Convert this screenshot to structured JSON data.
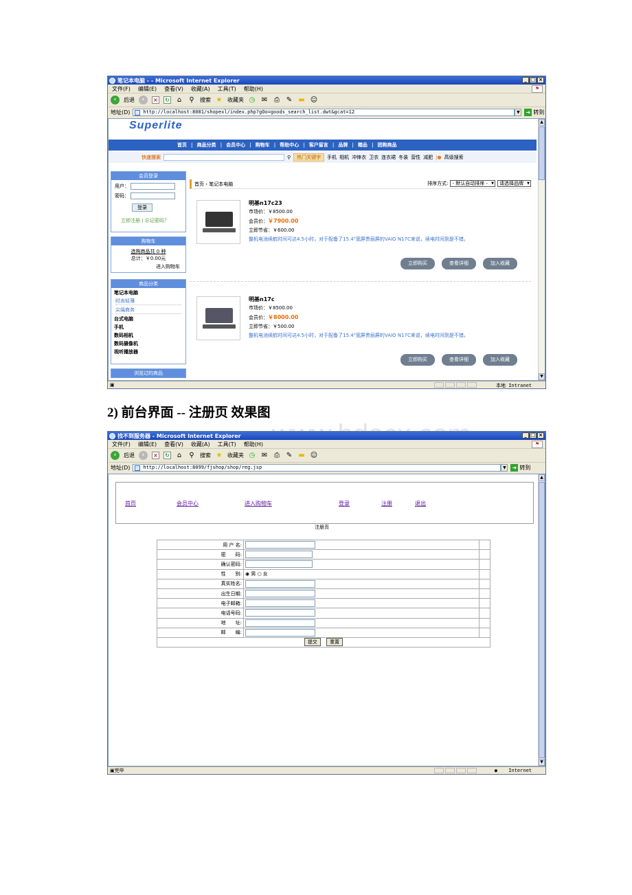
{
  "win1": {
    "title": "笔记本电脑 - - Microsoft Internet Explorer",
    "menu": [
      "文件(F)",
      "编辑(E)",
      "查看(V)",
      "收藏(A)",
      "工具(T)",
      "帮助(H)"
    ],
    "toolbar": {
      "back": "后退",
      "search": "搜索",
      "favorites": "收藏夹"
    },
    "address_label": "地址(D)",
    "address": "http://localhost:8081/shopexl/index.php?gOo=goods_search_list.dwt&gcat=12",
    "go": "转到",
    "status_zone": "本地 Intranet"
  },
  "shop": {
    "logo": "Superlite",
    "nav": [
      "首页",
      "商品分类",
      "会员中心",
      "购物车",
      "帮助中心",
      "客户留言",
      "品牌",
      "赠品",
      "团购商品"
    ],
    "search": {
      "label": "快速搜索",
      "hot": "热门关键字",
      "keywords": [
        "手机",
        "相机",
        "冲锋衣",
        "卫衣",
        "连衣裙",
        "冬装",
        "营性",
        "减肥"
      ],
      "advanced": "高级搜索"
    },
    "login": {
      "title": "会员登录",
      "user_label": "用户：",
      "pass_label": "密码：",
      "button": "登录",
      "register": "立即注册",
      "sep": "|",
      "forgot": "忘记密码？"
    },
    "cart": {
      "title": "购物车",
      "items": "选购商品共 0 种",
      "total": "总计：￥0.00元",
      "go": "进入购物车"
    },
    "categories": {
      "title": "商品分类",
      "items": [
        {
          "label": "笔记本电脑",
          "sub": false
        },
        {
          "label": "时尚轻薄",
          "sub": true
        },
        {
          "label": "尖端商务",
          "sub": true
        },
        {
          "label": "台式电脑",
          "sub": false
        },
        {
          "label": "手机",
          "sub": false
        },
        {
          "label": "数码相机",
          "sub": false
        },
        {
          "label": "数码摄像机",
          "sub": false
        },
        {
          "label": "视听播放器",
          "sub": false
        }
      ],
      "next_panel": "浏览过的商品"
    },
    "breadcrumb": "首页 › 笔记本电脑",
    "sort": {
      "label": "排序方式:",
      "order": "- 默认自动排序 -",
      "brand": "请选择品牌"
    },
    "products": [
      {
        "name": "明基n17c23",
        "market": "市场价：￥8500.00",
        "member_label": "会员价：",
        "member": "￥7900.00",
        "save": "立即节省：￥600.00",
        "desc": "整机电池续航时间可达4.5小时，对于配备了15.4\"宽屏贵丽屏的VAIO N17C来说，续电时间到是不错。"
      },
      {
        "name": "明基n17c",
        "market": "市场价：￥8500.00",
        "member_label": "会员价：",
        "member": "￥8000.00",
        "save": "立即节省：￥500.00",
        "desc": "整机电池续航时间可达4.5小时，对于配备了15.4\"宽屏贵丽屏的VAIO N17C来说，续电时间到是不错。"
      }
    ],
    "product_buttons": [
      "立即购买",
      "查看详细",
      "加入收藏"
    ]
  },
  "heading": "2) 前台界面 -- 注册页 效果图",
  "watermark": "www.bdocx.com",
  "win2": {
    "title": "找不到服务器 - Microsoft Internet Explorer",
    "address": "http://localhost:8099/fjshop/shop/reg.jsp",
    "status": "完毕",
    "status_zone": "Internet"
  },
  "reg": {
    "nav": [
      "首页",
      "会员中心",
      "进入购物车",
      "登录",
      "注册",
      "退出"
    ],
    "title": "注册页",
    "fields": [
      "用 户 名:",
      "密　　码:",
      "确认密码:",
      "性　　别:",
      "真实姓名:",
      "出生日期:",
      "电子邮箱:",
      "电话号码:",
      "地　　址:",
      "邮　　编:"
    ],
    "gender": {
      "male": "男",
      "female": "女"
    },
    "submit": "提交",
    "reset": "重置"
  },
  "colors": {
    "nav_blue": "#2c62c2",
    "price_orange": "#ee6b00",
    "link_purple": "#5d1a9e"
  }
}
